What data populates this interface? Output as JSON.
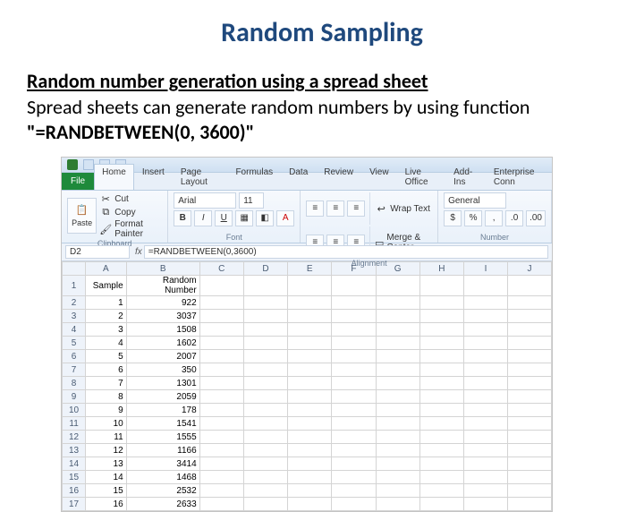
{
  "title": "Random Sampling",
  "subheading": "Random number generation using a spread sheet",
  "body_pre": "Spread sheets can generate random numbers by using function ",
  "body_bold": "\"=RANDBETWEEN(0, 3600)\"",
  "excel": {
    "file_tab": "File",
    "tabs": [
      "Home",
      "Insert",
      "Page Layout",
      "Formulas",
      "Data",
      "Review",
      "View",
      "Live Office",
      "Add-Ins",
      "Enterprise Conn"
    ],
    "active_tab": 0,
    "clipboard": {
      "paste": "Paste",
      "cut": "Cut",
      "copy": "Copy",
      "formatp": "Format Painter",
      "label": "Clipboard"
    },
    "font": {
      "name": "Arial",
      "size": "11",
      "label": "Font"
    },
    "alignment": {
      "wrap": "Wrap Text",
      "merge": "Merge & Center",
      "label": "Alignment"
    },
    "number": {
      "format": "General",
      "label": "Number"
    },
    "namebox": "D2",
    "fx": "fx",
    "formula": "=RANDBETWEEN(0,3600)",
    "cols": [
      "",
      "A",
      "B",
      "C",
      "D",
      "E",
      "F",
      "G",
      "H",
      "I",
      "J"
    ],
    "headers": {
      "A": "Sample",
      "B": "Random Number"
    },
    "rows": [
      {
        "n": "1",
        "a": "Sample",
        "b": "Random Number"
      },
      {
        "n": "2",
        "a": "1",
        "b": "922"
      },
      {
        "n": "3",
        "a": "2",
        "b": "3037"
      },
      {
        "n": "4",
        "a": "3",
        "b": "1508"
      },
      {
        "n": "5",
        "a": "4",
        "b": "1602"
      },
      {
        "n": "6",
        "a": "5",
        "b": "2007"
      },
      {
        "n": "7",
        "a": "6",
        "b": "350"
      },
      {
        "n": "8",
        "a": "7",
        "b": "1301"
      },
      {
        "n": "9",
        "a": "8",
        "b": "2059"
      },
      {
        "n": "10",
        "a": "9",
        "b": "178"
      },
      {
        "n": "11",
        "a": "10",
        "b": "1541"
      },
      {
        "n": "12",
        "a": "11",
        "b": "1555"
      },
      {
        "n": "13",
        "a": "12",
        "b": "1166"
      },
      {
        "n": "14",
        "a": "13",
        "b": "3414"
      },
      {
        "n": "15",
        "a": "14",
        "b": "1468"
      },
      {
        "n": "16",
        "a": "15",
        "b": "2532"
      },
      {
        "n": "17",
        "a": "16",
        "b": "2633"
      }
    ]
  }
}
